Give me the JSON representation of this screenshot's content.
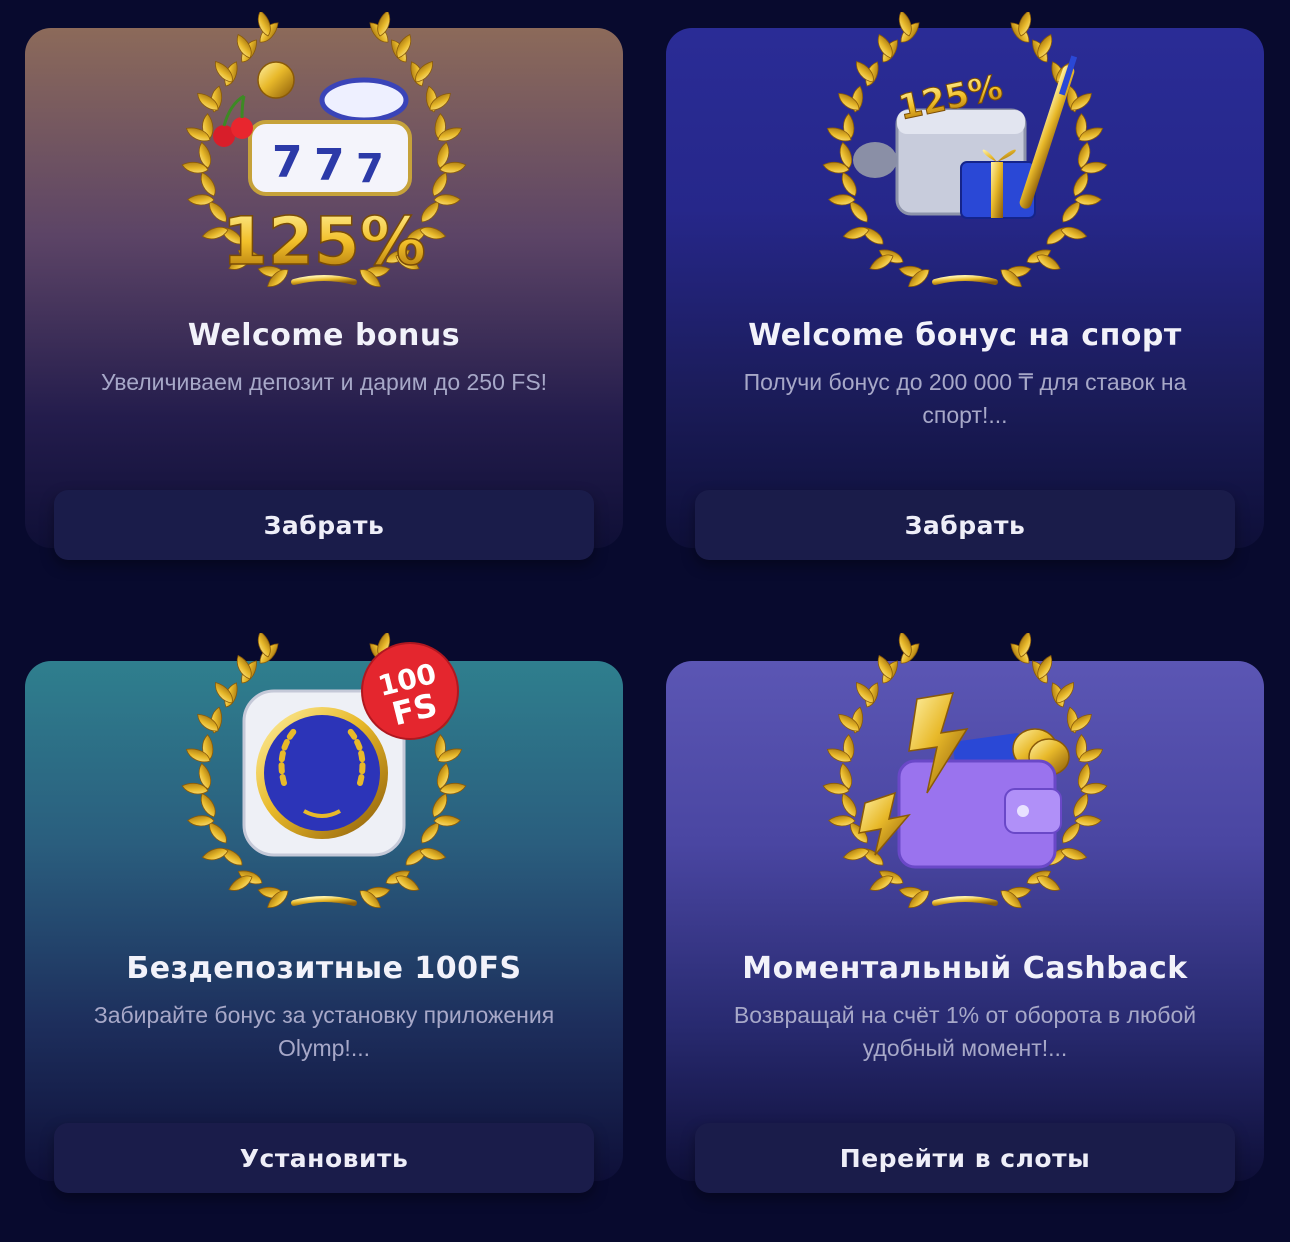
{
  "cards": [
    {
      "title": "Welcome bonus",
      "description": "Увеличиваем депозит и дарим до 250 FS!",
      "button": "Забрать",
      "art_text": "125%",
      "icon": "slot-machine-laurel-icon"
    },
    {
      "title": "Welcome бонус на спорт",
      "description": "Получи бонус до 200 000 ₸ для ставок на спорт!...",
      "button": "Забрать",
      "art_text": "125%",
      "icon": "sport-gift-laurel-icon"
    },
    {
      "title": "Бездепозитные 100FS",
      "description": "Забирайте бонус за установку приложения Olymp!...",
      "button": "Установить",
      "art_badge_top": "100",
      "art_badge_bottom": "FS",
      "icon": "app-badge-laurel-icon"
    },
    {
      "title": "Моментальный Cashback",
      "description": "Возвращай на счёт 1% от оборота в любой удобный момент!...",
      "button": "Перейти в слоты",
      "icon": "wallet-lightning-laurel-icon"
    }
  ],
  "colors": {
    "page_bg": "#080a2e",
    "button_bg": "#1a1c4a",
    "gold": "#e8b92a",
    "title": "#f2f2fa",
    "description": "#a7a8c8"
  }
}
